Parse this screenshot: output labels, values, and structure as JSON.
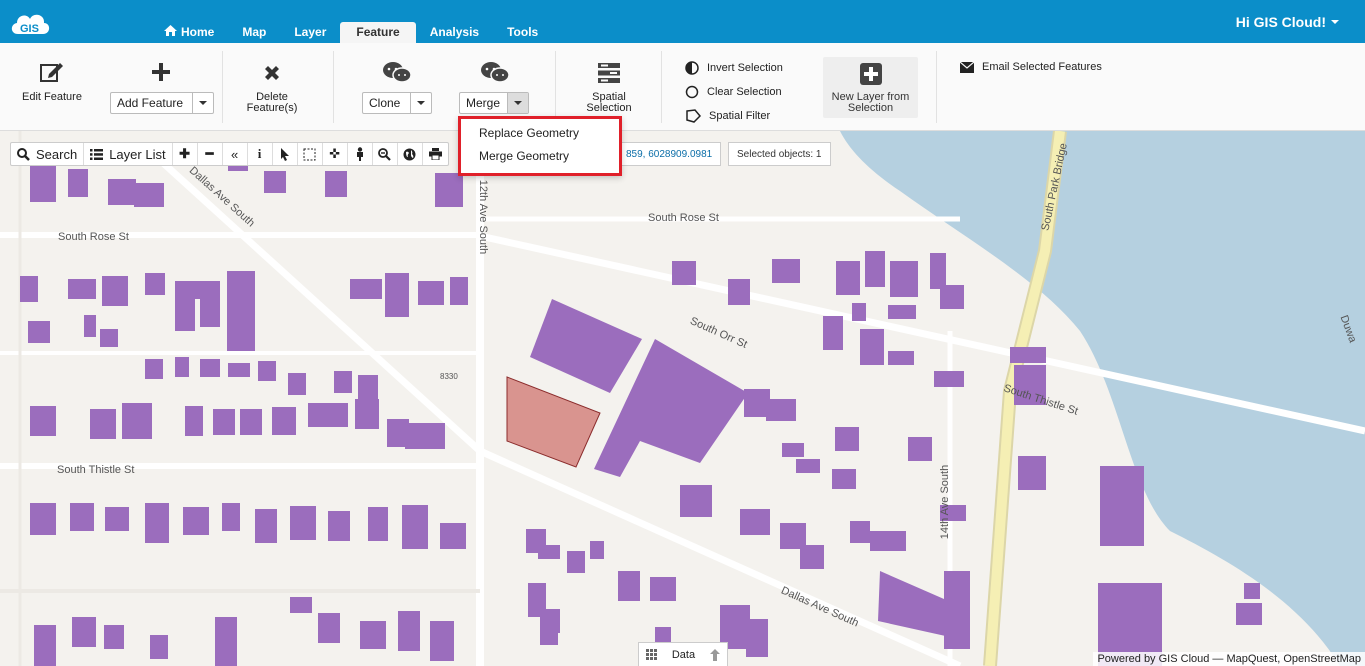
{
  "app": {
    "logo_text": "GIS",
    "greeting": "Hi GIS Cloud!"
  },
  "nav": {
    "tabs": [
      {
        "label": "Home",
        "icon": "home-icon"
      },
      {
        "label": "Map"
      },
      {
        "label": "Layer"
      },
      {
        "label": "Feature",
        "active": true
      },
      {
        "label": "Analysis"
      },
      {
        "label": "Tools"
      }
    ]
  },
  "ribbon": {
    "edit_feature": "Edit Feature",
    "add_feature": "Add Feature",
    "delete_feature_line1": "Delete",
    "delete_feature_line2": "Feature(s)",
    "clone": "Clone",
    "merge": "Merge",
    "spatial_selection_line1": "Spatial",
    "spatial_selection_line2": "Selection",
    "invert_selection": "Invert Selection",
    "clear_selection": "Clear Selection",
    "spatial_filter": "Spatial Filter",
    "new_layer_line1": "New Layer from",
    "new_layer_line2": "Selection",
    "email_selected": "Email Selected Features"
  },
  "merge_dropdown": {
    "items": [
      "Replace Geometry",
      "Merge Geometry"
    ]
  },
  "map_toolbar": {
    "search": "Search",
    "layer_list": "Layer List",
    "coordinates": "859, 6028909.0981",
    "selected_objects": "Selected objects: 1"
  },
  "map": {
    "streets": {
      "south_rose_left": "South Rose St",
      "south_rose_right": "South Rose St",
      "dallas_top": "Dallas Ave South",
      "twelfth": "12th Ave South",
      "south_orr": "South Orr St",
      "south_thistle_left": "South Thistle St",
      "south_thistle_right": "South Thistle St",
      "fourteenth": "14th Ave South",
      "dallas_bottom": "Dallas Ave South",
      "south_park_bridge": "South Park Bridge",
      "duwa": "Duwa",
      "addr": "8330"
    },
    "colors": {
      "building": "#9b6dbd",
      "selected": "#d9948f",
      "water": "#b5d0e0",
      "road": "#ffffff",
      "bridge": "#f5efb4"
    }
  },
  "bottom": {
    "data_tab": "Data",
    "attribution": "Powered by GIS Cloud — MapQuest, OpenStreetMap"
  }
}
